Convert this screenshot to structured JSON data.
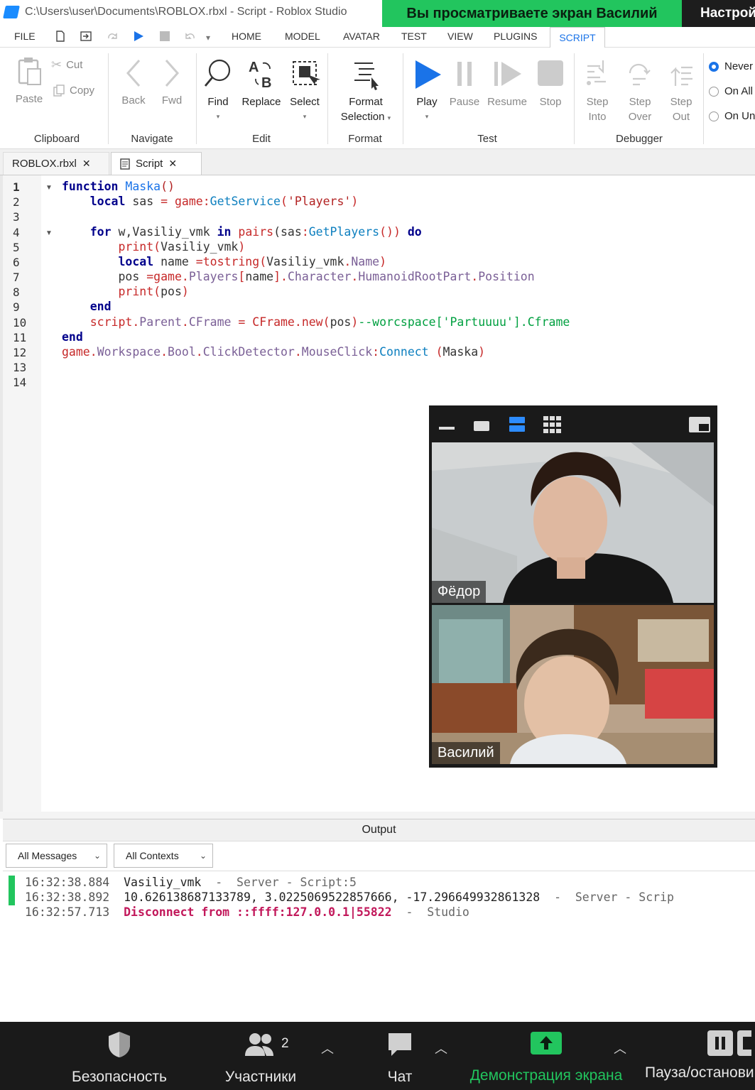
{
  "window": {
    "title": "C:\\Users\\user\\Documents\\ROBLOX.rbxl - Script - Roblox Studio",
    "share_banner": "Вы просматриваете экран Василий",
    "settings_label": "Настрой"
  },
  "menu": {
    "file": "FILE",
    "tabs": [
      "HOME",
      "MODEL",
      "AVATAR",
      "TEST",
      "VIEW",
      "PLUGINS",
      "SCRIPT"
    ],
    "active_tab": "SCRIPT"
  },
  "ribbon": {
    "clipboard": {
      "paste": "Paste",
      "cut": "Cut",
      "copy": "Copy",
      "group": "Clipboard"
    },
    "navigate": {
      "back": "Back",
      "fwd": "Fwd",
      "group": "Navigate"
    },
    "edit": {
      "find": "Find",
      "replace": "Replace",
      "select": "Select",
      "group": "Edit"
    },
    "format": {
      "format_selection_1": "Format",
      "format_selection_2": "Selection",
      "group": "Format"
    },
    "test": {
      "play": "Play",
      "pause": "Pause",
      "resume": "Resume",
      "stop": "Stop",
      "group": "Test"
    },
    "debugger": {
      "step_into_1": "Step",
      "step_into_2": "Into",
      "step_over_1": "Step",
      "step_over_2": "Over",
      "step_out_1": "Step",
      "step_out_2": "Out",
      "group": "Debugger"
    },
    "options": [
      "Never",
      "On All",
      "On Un"
    ],
    "selected_option": "Never"
  },
  "doc_tabs": [
    {
      "label": "ROBLOX.rbxl",
      "active": false
    },
    {
      "label": "Script",
      "active": true
    }
  ],
  "code": {
    "line_numbers": [
      "1",
      "2",
      "3",
      "4",
      "5",
      "6",
      "7",
      "8",
      "9",
      "10",
      "11",
      "12",
      "13",
      "14"
    ]
  },
  "video": {
    "participants": [
      {
        "name": "Фёдор"
      },
      {
        "name": "Василий"
      }
    ]
  },
  "output": {
    "title": "Output",
    "filter_messages": "All Messages",
    "filter_contexts": "All Contexts",
    "lines": [
      {
        "time": "16:32:38.884",
        "text": "Vasiliy_vmk",
        "meta": "  -  Server - Script:5"
      },
      {
        "time": "16:32:38.892",
        "text": "10.626138687133789, 3.0225069522857666, -17.296649932861328",
        "meta": "  -  Server - Scrip"
      },
      {
        "time": "16:32:57.713",
        "text": "Disconnect from ::ffff:127.0.0.1|55822",
        "meta": "  -  Studio"
      }
    ]
  },
  "zoom_bar": {
    "security": "Безопасность",
    "participants": "Участники",
    "participant_count": "2",
    "chat": "Чат",
    "share_screen": "Демонстрация экрана",
    "pause": "Пауза/останови"
  },
  "colors": {
    "share_green": "#22c55e",
    "script_tab_blue": "#1a73e8",
    "play_blue": "#1a73e8",
    "zoom_bar_bg": "#1a1a1a"
  }
}
